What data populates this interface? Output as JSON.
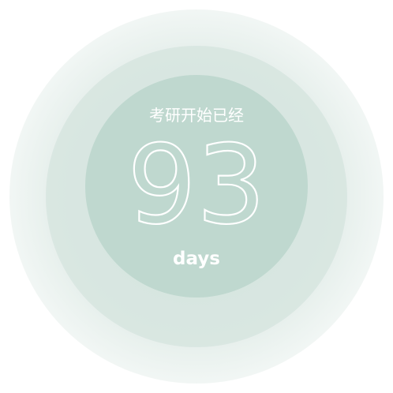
{
  "countdown": {
    "title": "考研开始已经",
    "value": "93",
    "unit": "days"
  },
  "colors": {
    "disk": "#bfd8cf",
    "text": "#ffffff"
  }
}
